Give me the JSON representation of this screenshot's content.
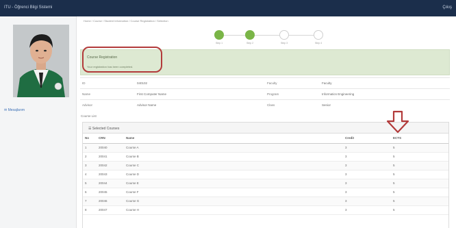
{
  "header": {
    "title": "ITU - Öğrenci Bilgi Sistemi",
    "user_label": "Çıkış"
  },
  "sidebar": {
    "photo_alt": "student photo",
    "link_label": "Mesajlarım"
  },
  "breadcrumb": "Home  /  Course  /  Student Information  /  Course Registration  /  Selection",
  "steps": [
    {
      "label": "Step 1",
      "state": "done"
    },
    {
      "label": "Step 2",
      "state": "done"
    },
    {
      "label": "Step 3",
      "state": "todo"
    },
    {
      "label": "Step 4",
      "state": "todo"
    }
  ],
  "alert": {
    "title": "Course Registration",
    "message": "Your registration has been completed."
  },
  "info": [
    [
      "ID",
      "040102",
      "Faculty",
      "Faculty"
    ],
    [
      "Name",
      "First Computer Name",
      "Program",
      "Informatics Engineering"
    ],
    [
      "Advisor",
      "Advisor Name",
      "Class",
      "Senior"
    ]
  ],
  "section_label": "Course List",
  "panel_title": "Selected Courses",
  "table": {
    "columns": [
      "No",
      "CRN",
      "Name",
      "Credit",
      "ECTS"
    ],
    "rows": [
      [
        "1",
        "20040",
        "Course A",
        "3",
        "5"
      ],
      [
        "2",
        "20041",
        "Course B",
        "3",
        "5"
      ],
      [
        "3",
        "20042",
        "Course C",
        "3",
        "5"
      ],
      [
        "4",
        "20043",
        "Course D",
        "3",
        "5"
      ],
      [
        "5",
        "20044",
        "Course E",
        "3",
        "5"
      ],
      [
        "6",
        "20045",
        "Course F",
        "3",
        "5"
      ],
      [
        "7",
        "20046",
        "Course G",
        "3",
        "5"
      ],
      [
        "8",
        "20047",
        "Course H",
        "3",
        "5"
      ]
    ]
  },
  "colors": {
    "topbar": "#1b2e4b",
    "alert_bg": "#dde9d2",
    "highlight_ring": "#b23a3a",
    "step_done": "#7ab547"
  },
  "icons": [
    "down-arrow-icon",
    "list-icon",
    "mail-icon"
  ]
}
